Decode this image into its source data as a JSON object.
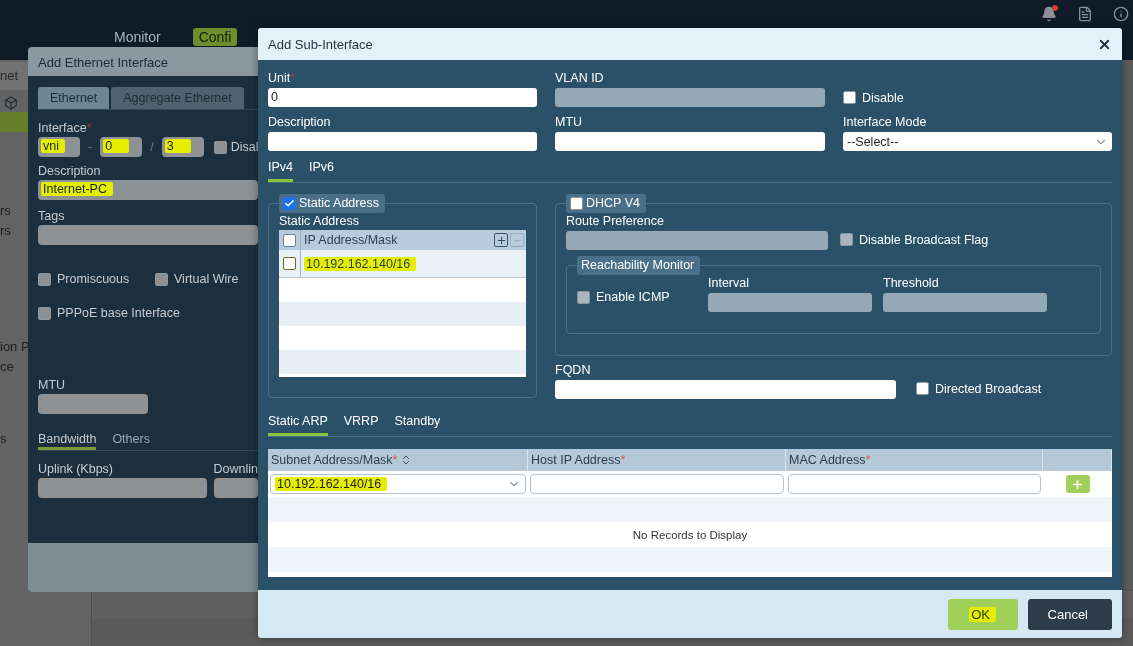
{
  "required_mark": "*",
  "nav": [
    {
      "label": "Monitor",
      "selected": false
    },
    {
      "label": "Confi",
      "selected": true
    }
  ],
  "sidebar": {
    "header": "net",
    "groups": [
      [
        {
          "selected": true
        }
      ],
      [
        {
          "label": "rs",
          "selected": false
        },
        {
          "label": "rs",
          "selected": false
        }
      ],
      [
        {
          "label": "ion P",
          "selected": false
        },
        {
          "label": "ce",
          "selected": false
        }
      ],
      [
        {
          "label": "s",
          "selected": false
        }
      ]
    ]
  },
  "ethernet_dialog": {
    "title": "Add Ethernet Interface",
    "tabs": [
      {
        "label": "Ethernet",
        "selected": true
      },
      {
        "label": "Aggregate Ethernet",
        "selected": false
      }
    ],
    "interface": {
      "label": "Interface",
      "required": true,
      "type": {
        "value": "vni",
        "highlighted": true
      },
      "separator_1": "-",
      "slot": {
        "value": "0",
        "highlighted": true
      },
      "separator_2": "/",
      "port": {
        "value": "3",
        "highlighted": true
      },
      "disable": {
        "label": "Disal",
        "checked": false
      }
    },
    "description": {
      "label": "Description",
      "value": "Internet-PC",
      "highlighted": true
    },
    "tags": {
      "label": "Tags"
    },
    "options": [
      {
        "label": "Promiscuous",
        "checked": false
      },
      {
        "label": "Virtual Wire",
        "checked": false
      },
      {
        "label": "PPPoE base Interface",
        "checked": false
      }
    ],
    "mtu": {
      "label": "MTU"
    },
    "bottom_tabs": [
      {
        "label": "Bandwidth",
        "selected": true
      },
      {
        "label": "Others",
        "selected": false
      }
    ],
    "uplink": {
      "label": "Uplink (Kbps)"
    },
    "downlink": {
      "label": "Downlin"
    }
  },
  "sub_interface_dialog": {
    "title": "Add Sub-Interface",
    "fields": [
      {
        "kind": "text",
        "label": "Unit",
        "required": true,
        "value": "0",
        "disabled": false
      },
      {
        "kind": "text",
        "label": "VLAN ID",
        "required": false,
        "disabled": true
      },
      {
        "kind": "checkbox",
        "label": "Disable",
        "checked": false
      },
      {
        "kind": "text",
        "label": "Description",
        "required": false,
        "disabled": false
      },
      {
        "kind": "text",
        "label": "MTU",
        "required": false,
        "disabled": false
      },
      {
        "kind": "select",
        "label": "Interface Mode",
        "value": "--Select--"
      }
    ],
    "ip_tabs": [
      {
        "label": "IPv4",
        "selected": true
      },
      {
        "label": "IPv6",
        "selected": false
      }
    ],
    "static_address": {
      "legend": "Static Address",
      "enabled": true,
      "label": "Static Address",
      "column": "IP Address/Mask",
      "header_checked": false,
      "rows": [
        {
          "value": "10.192.162.140/16",
          "checked": false,
          "highlighted": true
        }
      ]
    },
    "dhcp": {
      "legend": "DHCP V4",
      "enabled": false,
      "route_preference": {
        "label": "Route Preference"
      },
      "disable_broadcast_flag": {
        "label": "Disable Broadcast Flag",
        "checked": false
      },
      "reachability": {
        "legend": "Reachability Monitor",
        "enable_icmp": {
          "label": "Enable ICMP",
          "checked": false
        },
        "interval": {
          "label": "Interval"
        },
        "threshold": {
          "label": "Threshold"
        }
      }
    },
    "fqdn": {
      "label": "FQDN"
    },
    "directed_broadcast": {
      "label": "Directed Broadcast",
      "checked": false
    },
    "arp_tabs": [
      {
        "label": "Static ARP",
        "selected": true
      },
      {
        "label": "VRRP",
        "selected": false
      },
      {
        "label": "Standby",
        "selected": false
      }
    ],
    "arp_table": {
      "columns": [
        {
          "label": "Subnet Address/Mask",
          "required": true,
          "sortable": true
        },
        {
          "label": "Host IP Address",
          "required": true,
          "sortable": false
        },
        {
          "label": "MAC Address",
          "required": true,
          "sortable": false
        }
      ],
      "new_row": {
        "subnet": {
          "value": "10.192.162.140/16",
          "highlighted": true
        }
      },
      "empty_message": "No Records to Display"
    },
    "buttons": [
      {
        "label": "OK",
        "kind": "primary",
        "highlighted": true
      },
      {
        "label": "Cancel",
        "kind": "secondary",
        "highlighted": false
      }
    ]
  }
}
